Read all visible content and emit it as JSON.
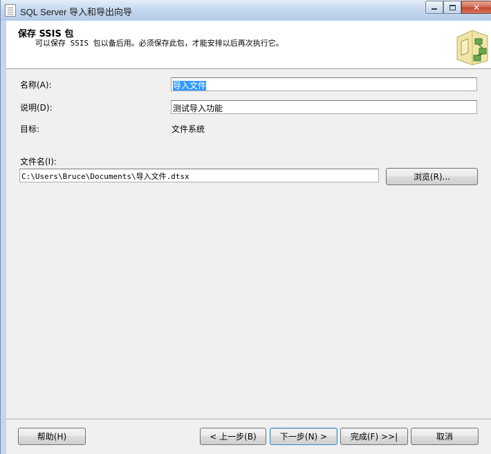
{
  "window": {
    "title": "SQL Server 导入和导出向导",
    "controls": {
      "minimize": "–",
      "maximize": "□",
      "close": "✕"
    }
  },
  "header": {
    "title": "保存 SSIS 包",
    "subtitle": "可以保存 SSIS 包以备后用。必须保存此包，才能安排以后再次执行它。",
    "graphic_icon": "wizard-package-icon"
  },
  "form": {
    "name_label": "名称(A):",
    "name_value": "导入文件",
    "description_label": "说明(D):",
    "description_value": "测试导入功能",
    "target_label": "目标:",
    "target_value": "文件系统",
    "filename_label": "文件名(I):",
    "filename_value": "C:\\Users\\Bruce\\Documents\\导入文件.dtsx",
    "browse_label": "浏览(R)..."
  },
  "footer": {
    "help": "帮助(H)",
    "back": "< 上一步(B)",
    "next": "下一步(N) >",
    "finish": "完成(F) >>|",
    "cancel": "取消"
  }
}
